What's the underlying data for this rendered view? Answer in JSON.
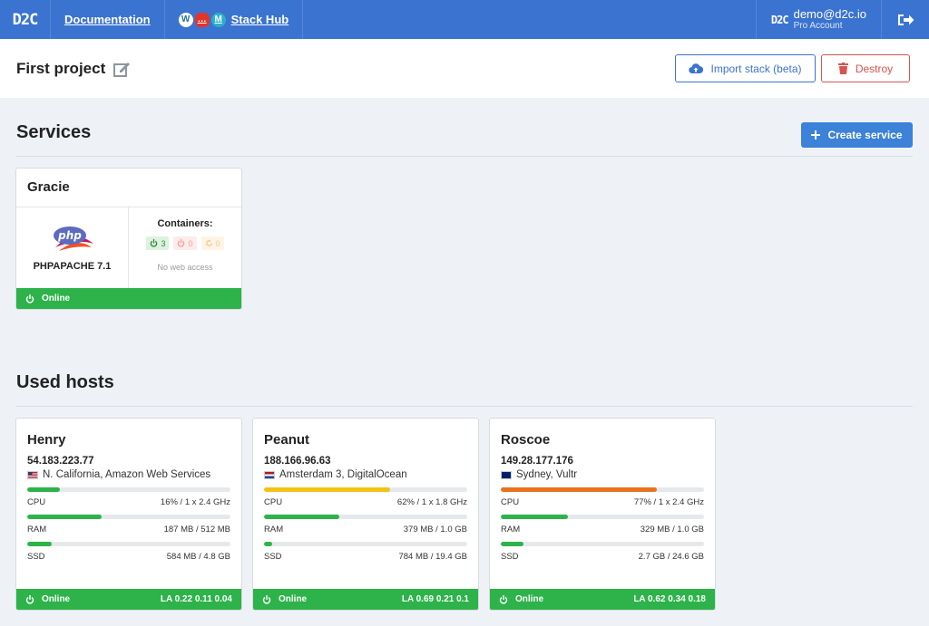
{
  "topbar": {
    "logo": "D2C",
    "documentation_label": "Documentation",
    "stackhub_label": "Stack Hub",
    "user_badge": "D2C",
    "user_email": "demo@d2c.io",
    "user_account": "Pro Account"
  },
  "project": {
    "title": "First project",
    "import_label": "Import stack (beta)",
    "destroy_label": "Destroy"
  },
  "services": {
    "title": "Services",
    "create_label": "Create service",
    "items": [
      {
        "name": "Gracie",
        "logo_text": "php",
        "type": "PHPAPACHE 7.1",
        "containers_label": "Containers:",
        "running": "3",
        "stopped": "0",
        "restarting": "0",
        "web_access": "No web access",
        "status": "Online"
      }
    ]
  },
  "hosts": {
    "title": "Used hosts",
    "items": [
      {
        "name": "Henry",
        "ip": "54.183.223.77",
        "location": "N. California, Amazon Web Services",
        "flag": "us",
        "cpu_label": "CPU",
        "cpu_value": "16% / 1 x 2.4 GHz",
        "cpu_fraction": 0.16,
        "cpu_color": "#2db34a",
        "ram_label": "RAM",
        "ram_value": "187 MB / 512 MB",
        "ram_fraction": 0.365,
        "ram_color": "#2db34a",
        "ssd_label": "SSD",
        "ssd_value": "584 MB / 4.8 GB",
        "ssd_fraction": 0.12,
        "ssd_color": "#2db34a",
        "status": "Online",
        "la": "LA 0.22 0.11 0.04"
      },
      {
        "name": "Peanut",
        "ip": "188.166.96.63",
        "location": "Amsterdam 3, DigitalOcean",
        "flag": "nl",
        "cpu_label": "CPU",
        "cpu_value": "62% / 1 x 1.8 GHz",
        "cpu_fraction": 0.62,
        "cpu_color": "#f6c116",
        "ram_label": "RAM",
        "ram_value": "379 MB / 1.0 GB",
        "ram_fraction": 0.37,
        "ram_color": "#2db34a",
        "ssd_label": "SSD",
        "ssd_value": "784 MB / 19.4 GB",
        "ssd_fraction": 0.04,
        "ssd_color": "#2db34a",
        "status": "Online",
        "la": "LA 0.69 0.21 0.1"
      },
      {
        "name": "Roscoe",
        "ip": "149.28.177.176",
        "location": "Sydney, Vultr",
        "flag": "au",
        "cpu_label": "CPU",
        "cpu_value": "77% / 1 x 2.4 GHz",
        "cpu_fraction": 0.77,
        "cpu_color": "#e8731f",
        "ram_label": "RAM",
        "ram_value": "329 MB / 1.0 GB",
        "ram_fraction": 0.33,
        "ram_color": "#2db34a",
        "ssd_label": "SSD",
        "ssd_value": "2.7 GB / 24.6 GB",
        "ssd_fraction": 0.11,
        "ssd_color": "#2db34a",
        "status": "Online",
        "la": "LA 0.62 0.34 0.18"
      }
    ]
  }
}
